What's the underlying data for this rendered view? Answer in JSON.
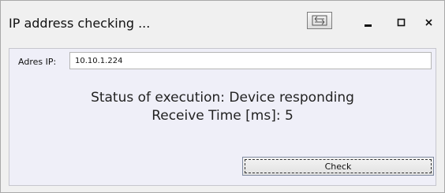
{
  "window": {
    "title": "IP address checking ...",
    "buttons": {
      "restore_icon": "restore-window-icon",
      "minimize_icon": "minimize-icon",
      "maximize_icon": "maximize-icon",
      "close_icon": "close-icon"
    }
  },
  "form": {
    "ip_label": "Adres IP:",
    "ip_value": "10.10.1.224"
  },
  "result": {
    "status": "Status of execution: Device responding",
    "receive_time": "Receive Time [ms]: 5"
  },
  "actions": {
    "check_label": "Check"
  },
  "colors": {
    "window_bg": "#f0f0f0",
    "panel_bg": "#efeff8",
    "text": "#222222"
  }
}
